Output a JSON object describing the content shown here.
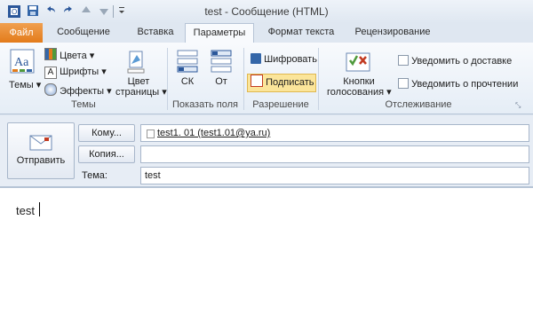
{
  "window": {
    "title": "test  -  Сообщение (HTML)"
  },
  "quick_access": [
    "save-icon",
    "undo-icon",
    "redo-icon",
    "up-arrow-icon",
    "down-arrow-icon",
    "customize-icon"
  ],
  "tabs": [
    {
      "label": "Файл",
      "active": false
    },
    {
      "label": "Сообщение",
      "active": false
    },
    {
      "label": "Вставка",
      "active": false
    },
    {
      "label": "Параметры",
      "active": true
    },
    {
      "label": "Формат текста",
      "active": false
    },
    {
      "label": "Рецензирование",
      "active": false
    }
  ],
  "ribbon": {
    "themes": {
      "themes_btn": "Темы",
      "colors": "Цвета",
      "fonts": "Шрифты",
      "effects": "Эффекты",
      "page_color_1": "Цвет",
      "page_color_2": "страницы",
      "group": "Темы"
    },
    "fields": {
      "bcc": "СК",
      "from": "От",
      "group": "Показать поля"
    },
    "permission": {
      "encrypt": "Шифровать",
      "sign": "Подписать",
      "group": "Разрешение"
    },
    "tracking": {
      "voting_1": "Кнопки",
      "voting_2": "голосования",
      "delivery": "Уведомить о доставке",
      "read": "Уведомить о прочтении",
      "group": "Отслеживание"
    }
  },
  "form": {
    "send": "Отправить",
    "to_btn": "Кому...",
    "to_value": "test1. 01 (test1.01@ya.ru)",
    "cc_btn": "Копия...",
    "cc_value": "",
    "subject_label": "Тема:",
    "subject_value": "test"
  },
  "body": {
    "text": "test"
  },
  "colors": {
    "file_tab": "#e37b1a",
    "accent": "#2b579a",
    "sign_highlight": "#fbe59a"
  }
}
